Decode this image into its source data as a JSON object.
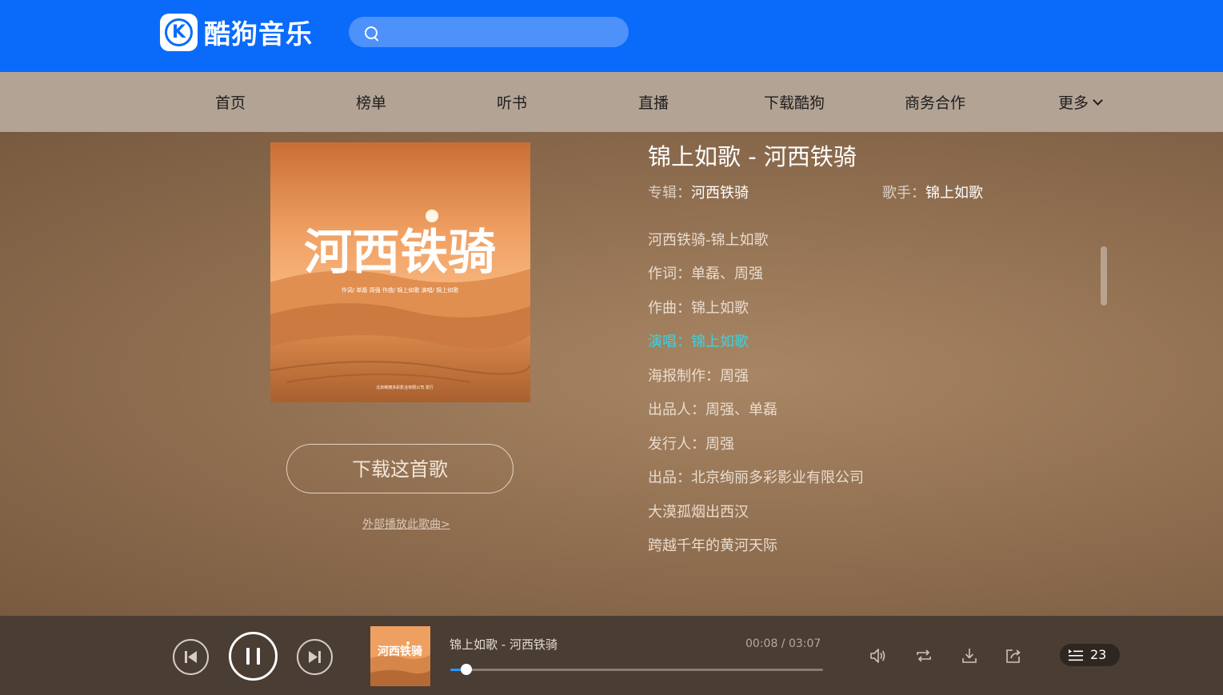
{
  "header": {
    "logo_text": "酷狗音乐",
    "logo_letter": "K",
    "search_placeholder": ""
  },
  "nav": {
    "items": [
      "首页",
      "榜单",
      "听书",
      "直播",
      "下载酷狗",
      "商务合作",
      "更多"
    ]
  },
  "song": {
    "title": "锦上如歌 - 河西铁骑",
    "album_label": "专辑：",
    "album": "河西铁骑",
    "singer_label": "歌手：",
    "singer": "锦上如歌",
    "download_label": "下载这首歌",
    "external_play_label": "外部播放此歌曲>"
  },
  "cover": {
    "title_text": "河西铁骑",
    "credits_line": "作词/ 单磊 周强    作曲/ 锦上如歌    演唱/ 锦上如歌",
    "publisher_line": "北京绚丽多彩影业有限公司 发行"
  },
  "lyrics": {
    "lines": [
      "河西铁骑-锦上如歌",
      "作词：单磊、周强",
      "作曲：锦上如歌",
      "演唱：锦上如歌",
      "海报制作：周强",
      "出品人：周强、单磊",
      "发行人：周强",
      "出品：北京绚丽多彩影业有限公司",
      "大漠孤烟出西汉",
      "跨越千年的黄河天际"
    ],
    "active_index": 3,
    "active_color": "#3ad3e0"
  },
  "player": {
    "now_playing": "锦上如歌 - 河西铁骑",
    "time": "00:08 / 03:07",
    "progress": 0.043,
    "playlist_count": "23",
    "accent": "#1e9bff"
  },
  "colors": {
    "header_blue": "#0a6bfa",
    "nav_bg": "#b3a394",
    "player_bg": "#4a3d34"
  }
}
